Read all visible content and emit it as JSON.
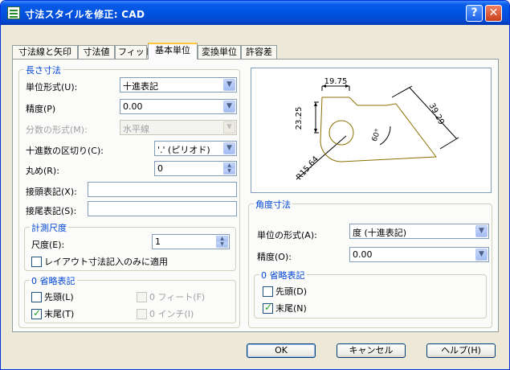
{
  "window": {
    "title": "寸法スタイルを修正: CAD",
    "help_btn": "?",
    "close_btn": "✕"
  },
  "tabs": [
    "寸法線と矢印",
    "寸法値",
    "フィット",
    "基本単位",
    "変換単位",
    "許容差"
  ],
  "linear": {
    "group_title": "長さ寸法",
    "unit_format_label": "単位形式(U):",
    "unit_format_value": "十進表記",
    "precision_label": "精度(P)",
    "precision_value": "0.00",
    "fraction_label": "分数の形式(M):",
    "fraction_value": "水平線",
    "decimal_sep_label": "十進数の区切り(C):",
    "decimal_sep_value": "'.' (ピリオド)",
    "roundoff_label": "丸め(R):",
    "roundoff_value": "0",
    "prefix_label": "接頭表記(X):",
    "prefix_value": "",
    "suffix_label": "接尾表記(S):",
    "suffix_value": ""
  },
  "scale": {
    "group_title": "計測尺度",
    "factor_label": "尺度(E):",
    "factor_value": "1",
    "layout_only_label": "レイアウト寸法記入のみに適用"
  },
  "zero_suppress_linear": {
    "group_title": "0 省略表記",
    "leading_label": "先頭(L)",
    "trailing_label": "末尾(T)",
    "feet_label": "0 フィート(F)",
    "inches_label": "0 インチ(I)"
  },
  "preview": {
    "dim_top": "19.75",
    "dim_left": "23.25",
    "dim_right": "39.29",
    "dim_angle": "60°",
    "dim_radius": "R15.64"
  },
  "angular": {
    "group_title": "角度寸法",
    "unit_format_label": "単位の形式(A):",
    "unit_format_value": "度 (十進表記)",
    "precision_label": "精度(O):",
    "precision_value": "0.00"
  },
  "zero_suppress_angular": {
    "group_title": "0 省略表記",
    "leading_label": "先頭(D)",
    "trailing_label": "末尾(N)"
  },
  "buttons": {
    "ok": "OK",
    "cancel": "キャンセル",
    "help": "ヘルプ(H)"
  },
  "icons": {
    "check": "✓",
    "combo_arrow": "▼",
    "spin_up": "▲",
    "spin_down": "▼"
  }
}
